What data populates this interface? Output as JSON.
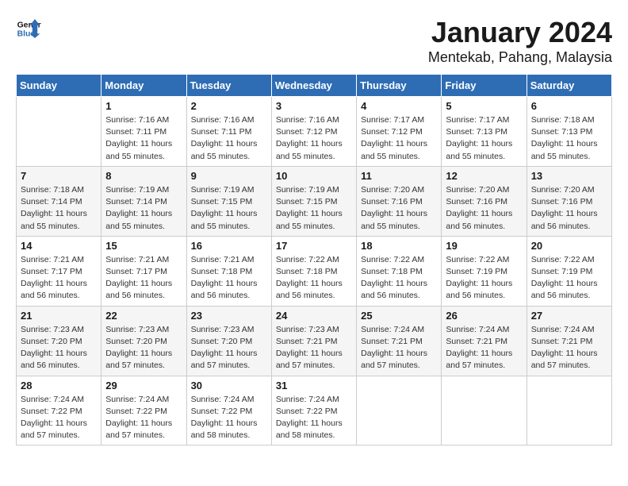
{
  "header": {
    "logo_line1": "General",
    "logo_line2": "Blue",
    "month": "January 2024",
    "location": "Mentekab, Pahang, Malaysia"
  },
  "days_of_week": [
    "Sunday",
    "Monday",
    "Tuesday",
    "Wednesday",
    "Thursday",
    "Friday",
    "Saturday"
  ],
  "weeks": [
    [
      {
        "day": "",
        "info": ""
      },
      {
        "day": "1",
        "info": "Sunrise: 7:16 AM\nSunset: 7:11 PM\nDaylight: 11 hours\nand 55 minutes."
      },
      {
        "day": "2",
        "info": "Sunrise: 7:16 AM\nSunset: 7:11 PM\nDaylight: 11 hours\nand 55 minutes."
      },
      {
        "day": "3",
        "info": "Sunrise: 7:16 AM\nSunset: 7:12 PM\nDaylight: 11 hours\nand 55 minutes."
      },
      {
        "day": "4",
        "info": "Sunrise: 7:17 AM\nSunset: 7:12 PM\nDaylight: 11 hours\nand 55 minutes."
      },
      {
        "day": "5",
        "info": "Sunrise: 7:17 AM\nSunset: 7:13 PM\nDaylight: 11 hours\nand 55 minutes."
      },
      {
        "day": "6",
        "info": "Sunrise: 7:18 AM\nSunset: 7:13 PM\nDaylight: 11 hours\nand 55 minutes."
      }
    ],
    [
      {
        "day": "7",
        "info": "Sunrise: 7:18 AM\nSunset: 7:14 PM\nDaylight: 11 hours\nand 55 minutes."
      },
      {
        "day": "8",
        "info": "Sunrise: 7:19 AM\nSunset: 7:14 PM\nDaylight: 11 hours\nand 55 minutes."
      },
      {
        "day": "9",
        "info": "Sunrise: 7:19 AM\nSunset: 7:15 PM\nDaylight: 11 hours\nand 55 minutes."
      },
      {
        "day": "10",
        "info": "Sunrise: 7:19 AM\nSunset: 7:15 PM\nDaylight: 11 hours\nand 55 minutes."
      },
      {
        "day": "11",
        "info": "Sunrise: 7:20 AM\nSunset: 7:16 PM\nDaylight: 11 hours\nand 55 minutes."
      },
      {
        "day": "12",
        "info": "Sunrise: 7:20 AM\nSunset: 7:16 PM\nDaylight: 11 hours\nand 56 minutes."
      },
      {
        "day": "13",
        "info": "Sunrise: 7:20 AM\nSunset: 7:16 PM\nDaylight: 11 hours\nand 56 minutes."
      }
    ],
    [
      {
        "day": "14",
        "info": "Sunrise: 7:21 AM\nSunset: 7:17 PM\nDaylight: 11 hours\nand 56 minutes."
      },
      {
        "day": "15",
        "info": "Sunrise: 7:21 AM\nSunset: 7:17 PM\nDaylight: 11 hours\nand 56 minutes."
      },
      {
        "day": "16",
        "info": "Sunrise: 7:21 AM\nSunset: 7:18 PM\nDaylight: 11 hours\nand 56 minutes."
      },
      {
        "day": "17",
        "info": "Sunrise: 7:22 AM\nSunset: 7:18 PM\nDaylight: 11 hours\nand 56 minutes."
      },
      {
        "day": "18",
        "info": "Sunrise: 7:22 AM\nSunset: 7:18 PM\nDaylight: 11 hours\nand 56 minutes."
      },
      {
        "day": "19",
        "info": "Sunrise: 7:22 AM\nSunset: 7:19 PM\nDaylight: 11 hours\nand 56 minutes."
      },
      {
        "day": "20",
        "info": "Sunrise: 7:22 AM\nSunset: 7:19 PM\nDaylight: 11 hours\nand 56 minutes."
      }
    ],
    [
      {
        "day": "21",
        "info": "Sunrise: 7:23 AM\nSunset: 7:20 PM\nDaylight: 11 hours\nand 56 minutes."
      },
      {
        "day": "22",
        "info": "Sunrise: 7:23 AM\nSunset: 7:20 PM\nDaylight: 11 hours\nand 57 minutes."
      },
      {
        "day": "23",
        "info": "Sunrise: 7:23 AM\nSunset: 7:20 PM\nDaylight: 11 hours\nand 57 minutes."
      },
      {
        "day": "24",
        "info": "Sunrise: 7:23 AM\nSunset: 7:21 PM\nDaylight: 11 hours\nand 57 minutes."
      },
      {
        "day": "25",
        "info": "Sunrise: 7:24 AM\nSunset: 7:21 PM\nDaylight: 11 hours\nand 57 minutes."
      },
      {
        "day": "26",
        "info": "Sunrise: 7:24 AM\nSunset: 7:21 PM\nDaylight: 11 hours\nand 57 minutes."
      },
      {
        "day": "27",
        "info": "Sunrise: 7:24 AM\nSunset: 7:21 PM\nDaylight: 11 hours\nand 57 minutes."
      }
    ],
    [
      {
        "day": "28",
        "info": "Sunrise: 7:24 AM\nSunset: 7:22 PM\nDaylight: 11 hours\nand 57 minutes."
      },
      {
        "day": "29",
        "info": "Sunrise: 7:24 AM\nSunset: 7:22 PM\nDaylight: 11 hours\nand 57 minutes."
      },
      {
        "day": "30",
        "info": "Sunrise: 7:24 AM\nSunset: 7:22 PM\nDaylight: 11 hours\nand 58 minutes."
      },
      {
        "day": "31",
        "info": "Sunrise: 7:24 AM\nSunset: 7:22 PM\nDaylight: 11 hours\nand 58 minutes."
      },
      {
        "day": "",
        "info": ""
      },
      {
        "day": "",
        "info": ""
      },
      {
        "day": "",
        "info": ""
      }
    ]
  ]
}
